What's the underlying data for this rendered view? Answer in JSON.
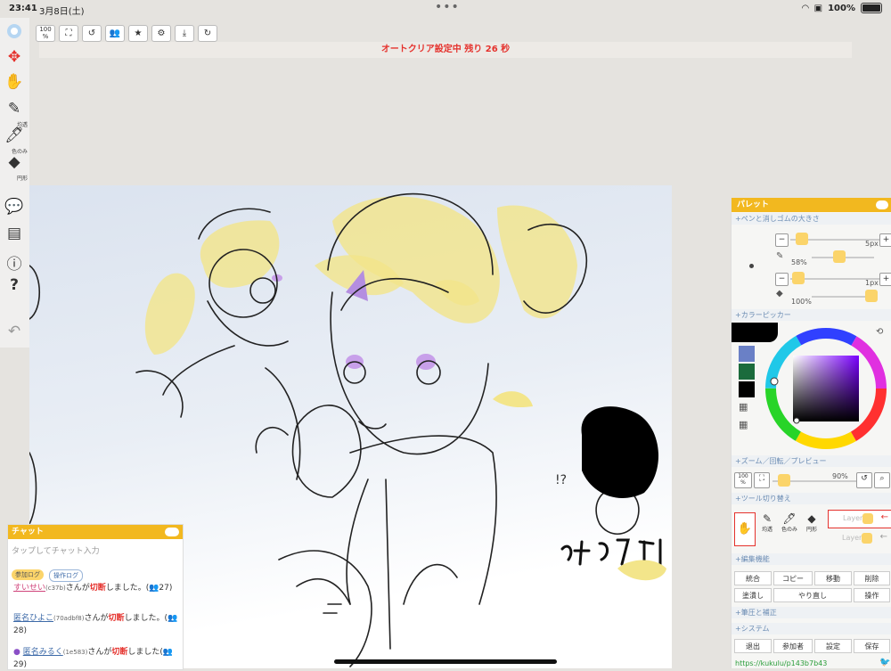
{
  "status": {
    "time": "23:41",
    "date": "3月8日(土)",
    "battery": "100%"
  },
  "toolbar": {
    "zoom_label": "100\n%"
  },
  "autoclear": {
    "text": "オートクリア設定中 残り 26 秒"
  },
  "left_tools": {
    "pen_label": "均透",
    "dropper_label": "色のみ",
    "eraser_label": "円形"
  },
  "palette": {
    "title": "パレット",
    "sections": {
      "pen_size": "+ペンと消しゴムの大きさ",
      "color_picker": "+カラーピッカー",
      "zoom": "+ズーム／回転／プレビュー",
      "tool_switch": "+ツール切り替え",
      "edit": "+編集機能",
      "pressure": "+筆圧と補正",
      "system": "+システム"
    },
    "pen_size": "5px",
    "pen_opacity": "58%",
    "eraser_size": "1px",
    "eraser_opacity": "100%",
    "zoom_label": "100\n%",
    "zoom_percent": "90%",
    "tool_labels": {
      "pen": "均透",
      "dropper": "色のみ",
      "eraser": "円形"
    },
    "layers": [
      "Layer1",
      "Layer2"
    ],
    "edit_buttons": [
      "統合",
      "コピー",
      "移動",
      "削除",
      "塗潰し",
      "やり直し",
      "操作"
    ],
    "system_buttons": [
      "退出",
      "参加者",
      "設定",
      "保存"
    ],
    "url": "https://kukulu/p143b7b43",
    "colors": {
      "swatch1": "#6a80c6",
      "swatch2": "#1b6b3c",
      "swatch3": "#000000"
    }
  },
  "chat": {
    "title": "チャット",
    "placeholder": "タップしてチャット入力",
    "tabs": [
      "参加ログ",
      "操作ログ"
    ],
    "messages": [
      {
        "user": "すいせい",
        "id": "(c37b)",
        "text": "さんが",
        "cut": "切断",
        "tail": "しました。(👥27)"
      },
      {
        "user": "匿名ひよこ",
        "id": "(70adbf8)",
        "text": "さんが",
        "cut": "切断",
        "tail": "しました。(👥28)"
      },
      {
        "user": "匿名みるく",
        "id": "(1e583)",
        "text": "さんが",
        "cut": "切断",
        "tail": "しました(👥29)"
      }
    ]
  },
  "canvas": {
    "annotation": "!?"
  }
}
